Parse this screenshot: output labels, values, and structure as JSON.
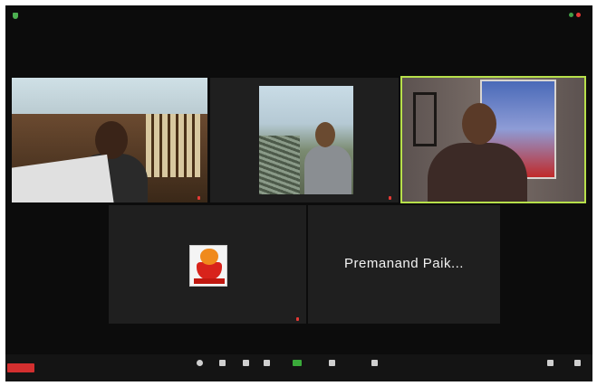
{
  "meeting": {
    "top_left_label": "",
    "top_right_label": ""
  },
  "participants": [
    {
      "name": ""
    },
    {
      "name": ""
    },
    {
      "name": ""
    },
    {
      "name": ""
    },
    {
      "name": "",
      "display_name": "Premanand Paik..."
    }
  ],
  "toolbar": {
    "leave_label": "",
    "items": [
      {
        "label": "",
        "icon": "circle-icon"
      },
      {
        "label": "",
        "icon": "security-icon"
      },
      {
        "label": "",
        "icon": "participants-icon"
      },
      {
        "label": "",
        "icon": "share-icon"
      },
      {
        "label": "",
        "icon": "chat-icon"
      },
      {
        "label": "",
        "icon": "record-icon"
      },
      {
        "label": "",
        "icon": "reactions-icon"
      },
      {
        "label": "",
        "icon": "view-icon"
      },
      {
        "label": "",
        "icon": "more-icon"
      }
    ]
  },
  "colors": {
    "active_speaker_border": "#b7e04a",
    "leave_button": "#d32f2f",
    "share_button": "#3aaa3a"
  }
}
